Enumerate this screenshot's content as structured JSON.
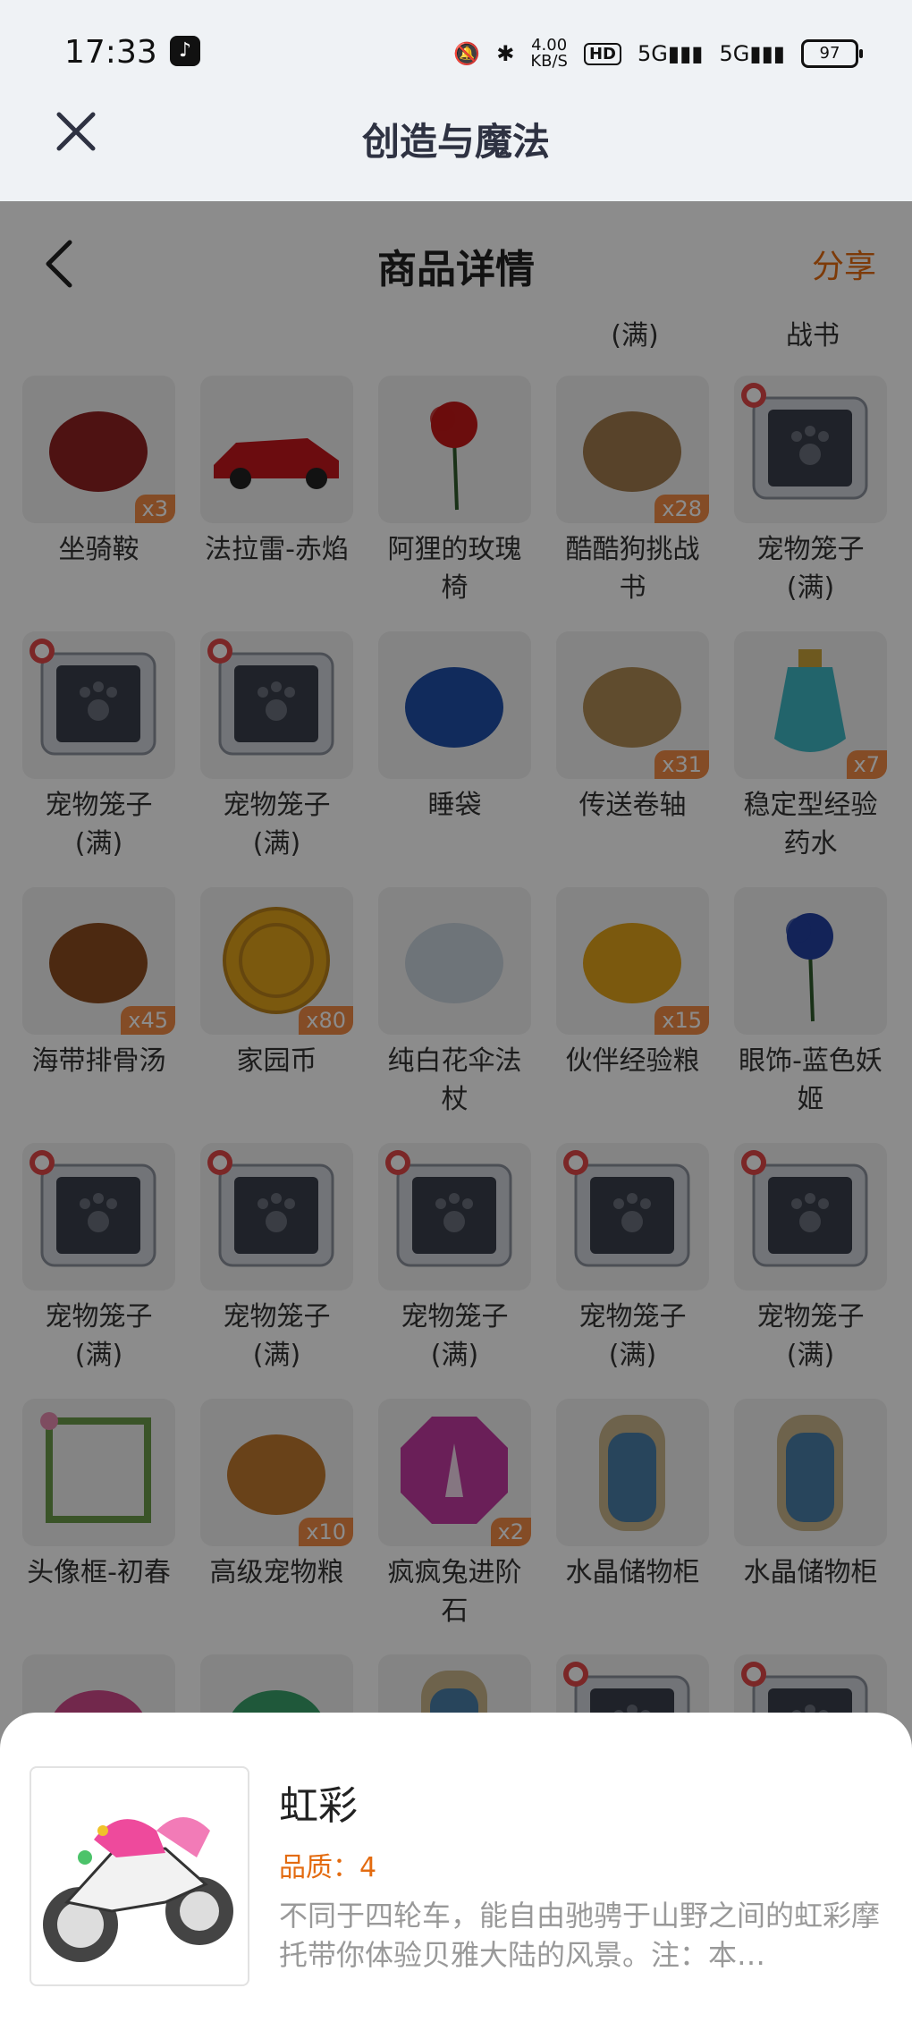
{
  "status": {
    "time": "17:33",
    "speed": "4.00",
    "speed_unit": "KB/S",
    "hd": "HD",
    "net1": "5G",
    "net2": "5G",
    "battery": "97"
  },
  "app": {
    "title": "创造与魔法"
  },
  "header": {
    "title": "商品详情",
    "share": "分享"
  },
  "top_partial": [
    "(满)",
    "战书"
  ],
  "items": [
    {
      "name": "坐骑鞍",
      "qty": "x3",
      "icon": "saddle-icon",
      "color": "#8e2222"
    },
    {
      "name": "法拉雷-赤焰",
      "qty": "",
      "icon": "car-icon",
      "color": "#c4161c"
    },
    {
      "name": "阿狸的玫瑰椅",
      "qty": "",
      "icon": "rose-icon",
      "color": "#c41818"
    },
    {
      "name": "酷酷狗挑战书",
      "qty": "x28",
      "icon": "scroll-icon",
      "color": "#a17a4d"
    },
    {
      "name": "宠物笼子(满)",
      "qty": "",
      "icon": "pet-cage-icon",
      "color": "#3a3f4b"
    },
    {
      "name": "宠物笼子(满)",
      "qty": "",
      "icon": "pet-cage-icon",
      "color": "#3a3f4b"
    },
    {
      "name": "宠物笼子(满)",
      "qty": "",
      "icon": "pet-cage-icon",
      "color": "#3a3f4b"
    },
    {
      "name": "睡袋",
      "qty": "",
      "icon": "sleeping-bag-icon",
      "color": "#1f4fa8"
    },
    {
      "name": "传送卷轴",
      "qty": "x31",
      "icon": "teleport-scroll-icon",
      "color": "#b08a55"
    },
    {
      "name": "稳定型经验药水",
      "qty": "x7",
      "icon": "potion-icon",
      "color": "#3fb7c4"
    },
    {
      "name": "海带排骨汤",
      "qty": "x45",
      "icon": "soup-icon",
      "color": "#8a4b1f"
    },
    {
      "name": "家园币",
      "qty": "x80",
      "icon": "coin-icon",
      "color": "#e0a21a"
    },
    {
      "name": "纯白花伞法杖",
      "qty": "",
      "icon": "umbrella-icon",
      "color": "#c9d3dd"
    },
    {
      "name": "伙伴经验粮",
      "qty": "x15",
      "icon": "bag-icon",
      "color": "#e0a21a"
    },
    {
      "name": "眼饰-蓝色妖姬",
      "qty": "",
      "icon": "blue-rose-icon",
      "color": "#2340a0"
    },
    {
      "name": "宠物笼子(满)",
      "qty": "",
      "icon": "pet-cage-icon",
      "color": "#3a3f4b"
    },
    {
      "name": "宠物笼子(满)",
      "qty": "",
      "icon": "pet-cage-icon",
      "color": "#3a3f4b"
    },
    {
      "name": "宠物笼子(满)",
      "qty": "",
      "icon": "pet-cage-icon",
      "color": "#3a3f4b"
    },
    {
      "name": "宠物笼子(满)",
      "qty": "",
      "icon": "pet-cage-icon",
      "color": "#3a3f4b"
    },
    {
      "name": "宠物笼子(满)",
      "qty": "",
      "icon": "pet-cage-icon",
      "color": "#3a3f4b"
    },
    {
      "name": "头像框-初春",
      "qty": "",
      "icon": "avatar-frame-icon",
      "color": "#6a9a4a"
    },
    {
      "name": "高级宠物粮",
      "qty": "x10",
      "icon": "pet-food-icon",
      "color": "#c0782e"
    },
    {
      "name": "疯疯兔进阶石",
      "qty": "x2",
      "icon": "gem-icon",
      "color": "#c23aa0"
    },
    {
      "name": "水晶储物柜",
      "qty": "",
      "icon": "cabinet-icon",
      "color": "#4a7fa8"
    },
    {
      "name": "水晶储物柜",
      "qty": "",
      "icon": "cabinet-icon",
      "color": "#4a7fa8"
    },
    {
      "name": "",
      "qty": "",
      "icon": "partial-item-icon",
      "color": "#d04a8a"
    },
    {
      "name": "",
      "qty": "",
      "icon": "partial-item-icon",
      "color": "#3aa06a"
    },
    {
      "name": "",
      "qty": "",
      "icon": "cabinet-icon",
      "color": "#4a7fa8"
    },
    {
      "name": "",
      "qty": "",
      "icon": "pet-cage-icon",
      "color": "#3a3f4b"
    },
    {
      "name": "",
      "qty": "",
      "icon": "pet-cage-icon",
      "color": "#3a3f4b"
    }
  ],
  "detail": {
    "name": "虹彩",
    "quality": "品质：4",
    "description": "不同于四轮车，能自由驰骋于山野之间的虹彩摩托带你体验贝雅大陆的风景。注：本…",
    "image_icon": "rainbow-motorcycle-icon"
  }
}
